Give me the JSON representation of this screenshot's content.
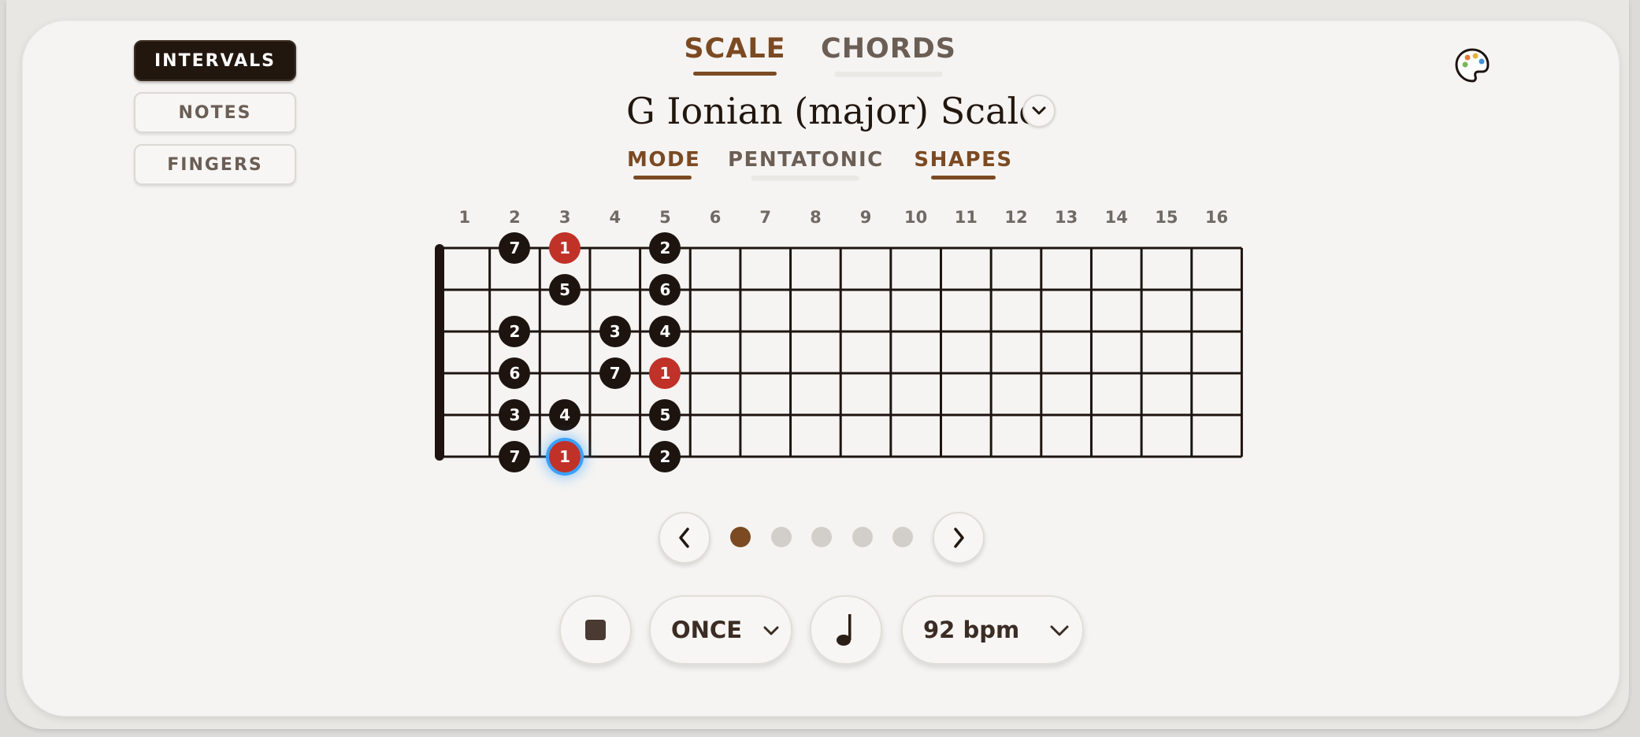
{
  "display_modes": [
    "INTERVALS",
    "NOTES",
    "FINGERS"
  ],
  "main_tabs": [
    "SCALE",
    "CHORDS"
  ],
  "scale_title": "G Ionian (major) Scale",
  "sub_tabs": [
    "MODE",
    "PENTATONIC",
    "SHAPES"
  ],
  "fret_numbers": [
    "1",
    "2",
    "3",
    "4",
    "5",
    "6",
    "7",
    "8",
    "9",
    "10",
    "11",
    "12",
    "13",
    "14",
    "15",
    "16"
  ],
  "fretboard_notes": [
    {
      "string": 1,
      "fret": 2,
      "label": "7",
      "root": false
    },
    {
      "string": 1,
      "fret": 3,
      "label": "1",
      "root": true
    },
    {
      "string": 1,
      "fret": 5,
      "label": "2",
      "root": false
    },
    {
      "string": 2,
      "fret": 3,
      "label": "5",
      "root": false
    },
    {
      "string": 2,
      "fret": 5,
      "label": "6",
      "root": false
    },
    {
      "string": 3,
      "fret": 2,
      "label": "2",
      "root": false
    },
    {
      "string": 3,
      "fret": 4,
      "label": "3",
      "root": false
    },
    {
      "string": 3,
      "fret": 5,
      "label": "4",
      "root": false
    },
    {
      "string": 4,
      "fret": 2,
      "label": "6",
      "root": false
    },
    {
      "string": 4,
      "fret": 4,
      "label": "7",
      "root": false
    },
    {
      "string": 4,
      "fret": 5,
      "label": "1",
      "root": true
    },
    {
      "string": 5,
      "fret": 2,
      "label": "3",
      "root": false
    },
    {
      "string": 5,
      "fret": 3,
      "label": "4",
      "root": false
    },
    {
      "string": 5,
      "fret": 5,
      "label": "5",
      "root": false
    },
    {
      "string": 6,
      "fret": 2,
      "label": "7",
      "root": false
    },
    {
      "string": 6,
      "fret": 3,
      "label": "1",
      "root": true,
      "selected": true
    },
    {
      "string": 6,
      "fret": 5,
      "label": "2",
      "root": false
    }
  ],
  "shape_pages": {
    "count": 5,
    "current": 1
  },
  "playback": {
    "repeat": "ONCE",
    "tempo": "92 bpm"
  },
  "icons": {
    "stop": "stop-icon",
    "note": "quarter-note-icon",
    "palette": "palette-icon",
    "prev": "chevron-left-icon",
    "next": "chevron-right-icon",
    "dropdown": "chevron-down-icon"
  },
  "colors": {
    "accent": "#7c4a22",
    "dark": "#22170f",
    "root": "#c03128",
    "selected_glow": "#3aa0ff",
    "muted": "#6b5e55"
  }
}
